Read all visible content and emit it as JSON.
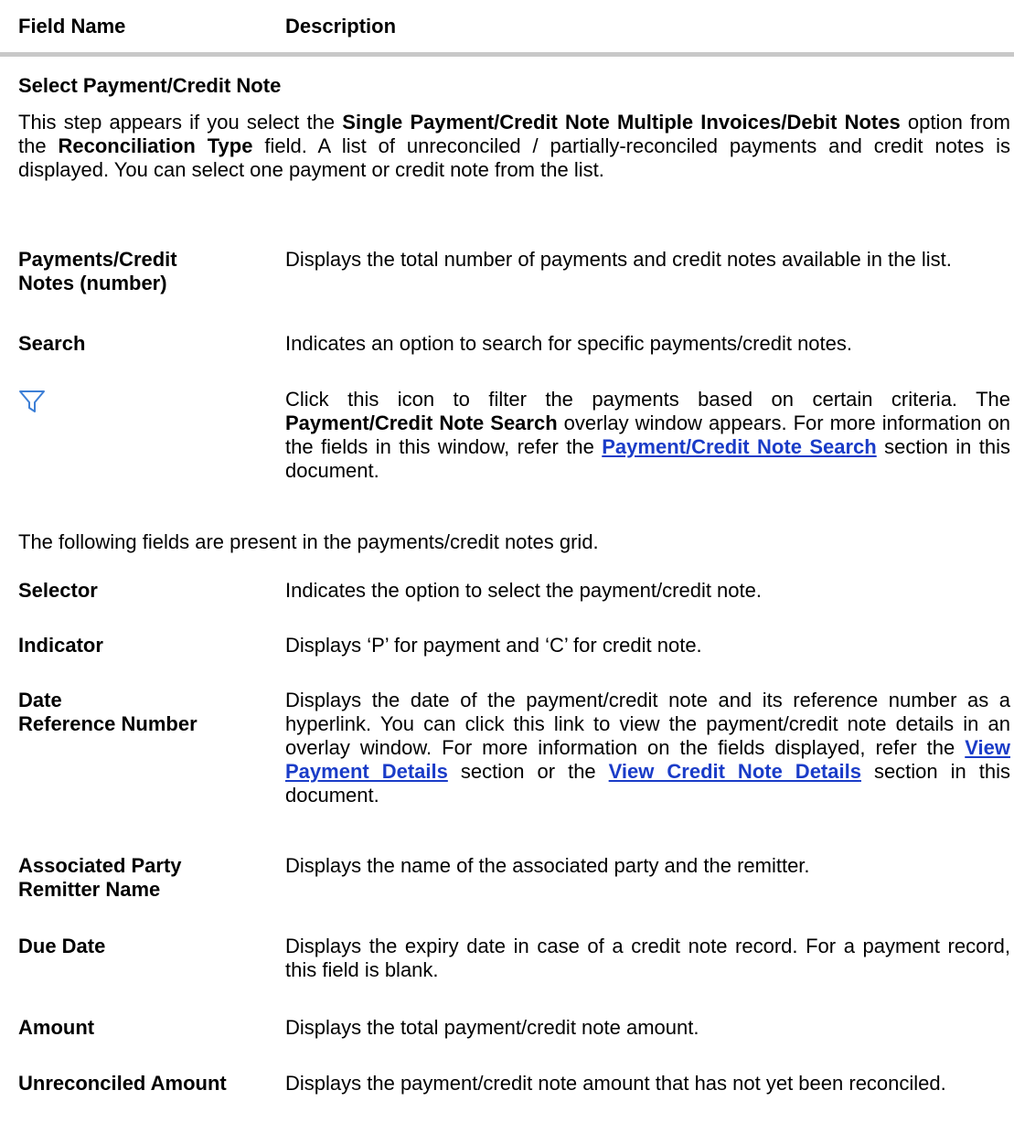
{
  "header": {
    "field_name": "Field Name",
    "description": "Description"
  },
  "section": {
    "title": "Select Payment/Credit Note",
    "intro_1": "This step appears if you select the ",
    "intro_b1": "Single Payment/Credit Note Multiple Invoices/Debit Notes",
    "intro_2": " option from the ",
    "intro_b2": "Reconciliation Type",
    "intro_3": " field. A list of unreconciled / partially-reconciled payments and credit notes is displayed. You can select one payment or credit note from the list."
  },
  "fields": {
    "payments_count": {
      "name_line1": "Payments/Credit",
      "name_line2": "Notes (number)",
      "desc": "Displays the total number of payments and credit notes available in the list."
    },
    "search": {
      "name": "Search",
      "desc": "Indicates an option to search for specific payments/credit notes."
    },
    "filter": {
      "icon": "filter-icon",
      "desc_1": "Click this icon to filter the payments based on certain criteria. The ",
      "desc_b1": "Payment/Credit Note Search",
      "desc_2": " overlay window appears. For more information on the fields in this window, refer the ",
      "desc_link": "Payment/Credit Note Search",
      "desc_3": " section in this document."
    }
  },
  "grid_intro": "The following fields are present in the payments/credit notes grid.",
  "grid_fields": {
    "selector": {
      "name": "Selector",
      "desc": "Indicates the option to select the payment/credit note."
    },
    "indicator": {
      "name": "Indicator",
      "desc": "Displays ‘P’ for payment and ‘C’ for credit note."
    },
    "date_ref": {
      "name_line1": "Date",
      "name_line2": "Reference Number",
      "desc_1": "Displays the date of the payment/credit note and its reference number as a hyperlink. You can click this link to view the payment/credit note details in an overlay window. For more information on the fields displayed, refer the ",
      "link_1": "View Payment Details",
      "desc_2": " section or the ",
      "link_2": "View Credit Note Details",
      "desc_3": " section in this document."
    },
    "associated_party": {
      "name_line1": "Associated Party",
      "name_line2": "Remitter Name",
      "desc": "Displays the name of the associated party and the remitter."
    },
    "due_date": {
      "name": "Due Date",
      "desc": "Displays the expiry date in case of a credit note record. For a payment record, this field is blank."
    },
    "amount": {
      "name": "Amount",
      "desc": "Displays the total payment/credit note amount."
    },
    "unreconciled": {
      "name": "Unreconciled Amount",
      "desc": "Displays the payment/credit note amount that has not yet been reconciled."
    }
  },
  "colors": {
    "link": "#1a3cc8",
    "icon": "#3d7fd6",
    "header_rule": "#c8c8c8"
  }
}
